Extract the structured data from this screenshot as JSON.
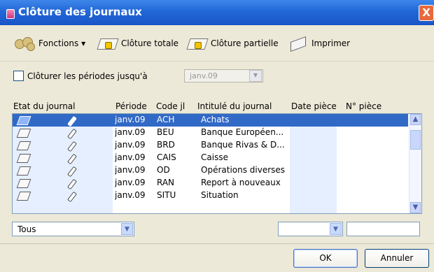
{
  "window": {
    "title": "Clôture des journaux",
    "close": "X"
  },
  "toolbar": {
    "functions": "Fonctions ▾",
    "closeTotal": "Clôture totale",
    "closePartial": "Clôture partielle",
    "print": "Imprimer"
  },
  "periods": {
    "label": "Clôturer les périodes jusqu'à",
    "value": "janv.09"
  },
  "table": {
    "headers": [
      "Etat du journal",
      "Période",
      "Code jl",
      "Intitulé du journal",
      "Date pièce",
      "N° pièce"
    ],
    "rows": [
      {
        "period": "janv.09",
        "code": "ACH",
        "title": "Achats",
        "selected": true
      },
      {
        "period": "janv.09",
        "code": "BEU",
        "title": "Banque Européen...",
        "selected": false
      },
      {
        "period": "janv.09",
        "code": "BRD",
        "title": "Banque Rivas & D...",
        "selected": false
      },
      {
        "period": "janv.09",
        "code": "CAIS",
        "title": "Caisse",
        "selected": false
      },
      {
        "period": "janv.09",
        "code": "OD",
        "title": "Opérations diverses",
        "selected": false
      },
      {
        "period": "janv.09",
        "code": "RAN",
        "title": "Report à nouveaux",
        "selected": false
      },
      {
        "period": "janv.09",
        "code": "SITU",
        "title": "Situation",
        "selected": false
      }
    ]
  },
  "filters": {
    "state": "Tous",
    "date": ""
  },
  "buttons": {
    "ok": "OK",
    "cancel": "Annuler"
  },
  "colors": {
    "titlebar": "#2167d8",
    "selection": "#3169c6",
    "dialog": "#ece9d8"
  },
  "icons": [
    "gear-icon",
    "closure-book-icon",
    "print-icon",
    "journal-icon",
    "pencil-icon"
  ]
}
